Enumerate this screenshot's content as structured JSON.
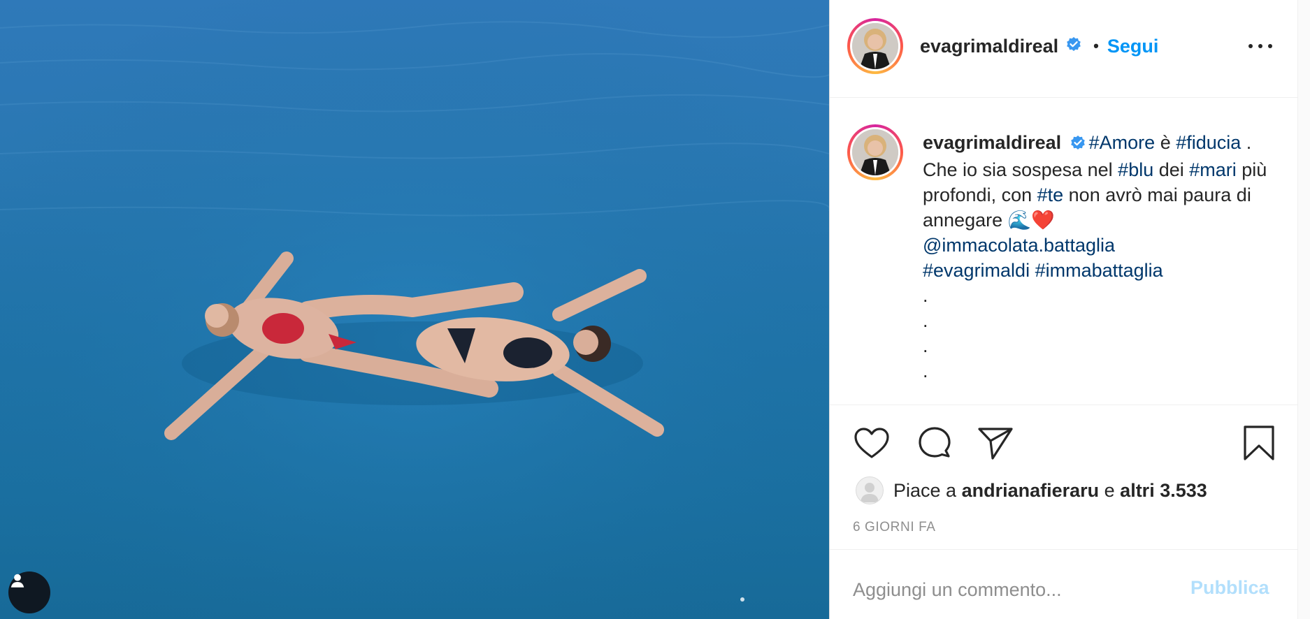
{
  "post": {
    "username": "evagrimaldireal",
    "follow_label": "Segui",
    "separator": "•",
    "caption": {
      "username": "evagrimaldireal",
      "seg1_tag": "#Amore",
      "seg1_text": " è ",
      "seg2_tag": "#fiducia",
      "seg2_text": " . Che io sia sospesa nel ",
      "seg3_tag": "#blu",
      "seg3_text": " dei ",
      "seg4_tag": "#mari",
      "seg4_text": " più profondi, con ",
      "seg5_tag": "#te",
      "seg5_text": " non avrò mai paura di annegare 🌊❤️",
      "mention": "@immacolata.battaglia",
      "tag_a": "#evagrimaldi",
      "tag_b": "#immabattaglia",
      "dots": [
        ".",
        ".",
        ".",
        "."
      ]
    },
    "likes": {
      "prefix": "Piace a ",
      "user": "andrianafieraru",
      "middle": " e ",
      "others": "altri 3.533"
    },
    "timestamp": "6 GIORNI FA",
    "comment_placeholder": "Aggiungi un commento...",
    "publish_label": "Pubblica"
  },
  "icons": {
    "verified": "verified-badge-icon",
    "more": "more-options-icon",
    "like": "heart-icon",
    "comment": "comment-bubble-icon",
    "share": "paper-plane-icon",
    "save": "bookmark-icon",
    "profile": "user-icon"
  },
  "colors": {
    "link": "#00376b",
    "follow": "#0095f6",
    "publish_disabled": "#b2dffc",
    "verified": "#3897f0"
  }
}
